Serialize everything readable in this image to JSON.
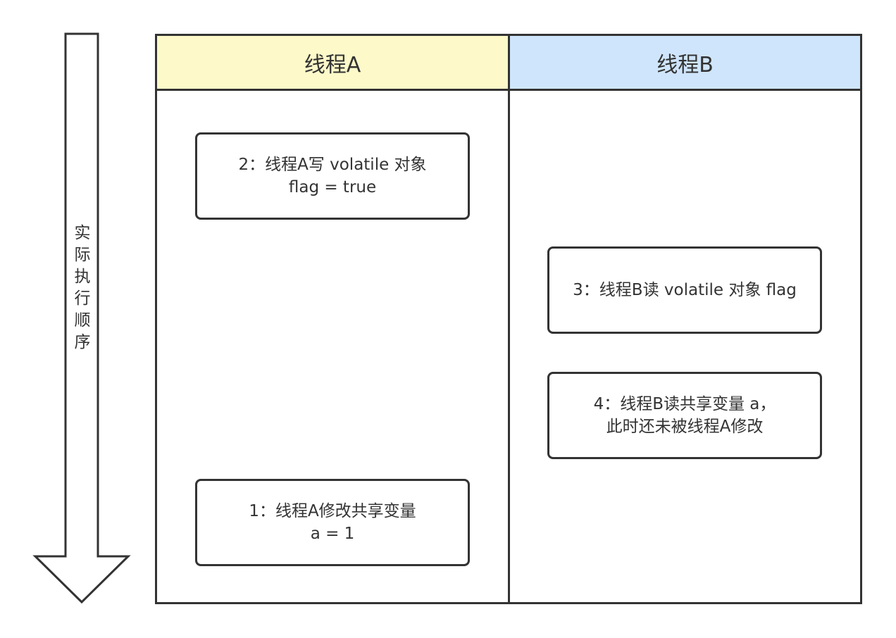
{
  "timeline": {
    "label_chars": [
      "实",
      "际",
      "执",
      "行",
      "顺",
      "序"
    ]
  },
  "columns": {
    "thread_a": {
      "title": "线程A",
      "color": "#fdf9c9"
    },
    "thread_b": {
      "title": "线程B",
      "color": "#cfe5fc"
    }
  },
  "steps": {
    "step1": {
      "line1": "1：线程A修改共享变量",
      "line2": "a = 1"
    },
    "step2": {
      "line1": "2：线程A写 volatile 对象",
      "line2": "flag = true"
    },
    "step3": {
      "line1": "3：线程B读 volatile 对象 flag"
    },
    "step4": {
      "line1": "4：线程B读共享变量 a，",
      "line2": "此时还未被线程A修改"
    }
  },
  "colors": {
    "stroke": "#333333",
    "background": "#ffffff"
  }
}
